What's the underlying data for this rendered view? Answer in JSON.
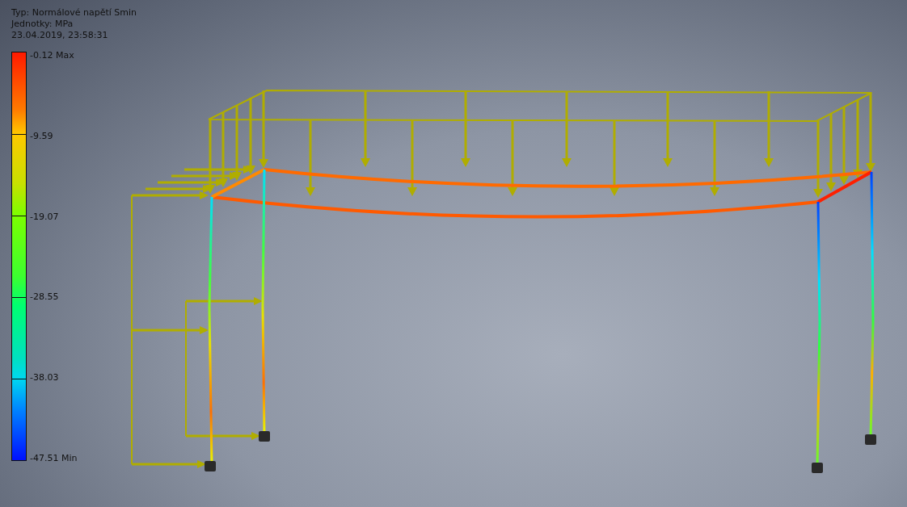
{
  "header": {
    "type_line": "Typ: Normálové napětí Smin",
    "units_line": "Jednotky: MPa",
    "timestamp": "23.04.2019, 23:58:31"
  },
  "legend": {
    "ticks": [
      "-0.12 Max",
      "-9.59",
      "-19.07",
      "-28.55",
      "-38.03",
      "-47.51 Min"
    ]
  }
}
